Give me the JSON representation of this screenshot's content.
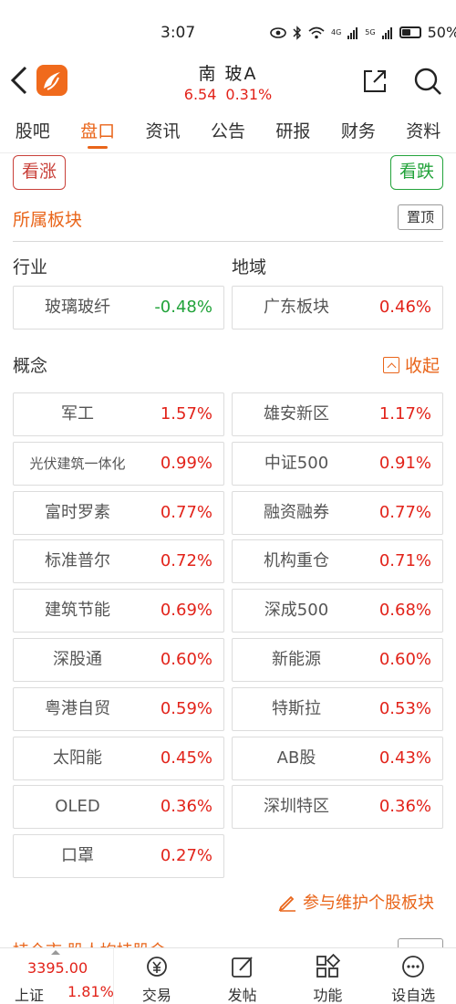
{
  "status": {
    "time": "3:07",
    "net1": "4G",
    "net2": "5G",
    "battery": "50%"
  },
  "header": {
    "name": "南 玻A",
    "price": "6.54",
    "change": "0.31%"
  },
  "tabs": [
    "股吧",
    "盘口",
    "资讯",
    "公告",
    "研报",
    "财务",
    "资料"
  ],
  "buttons": {
    "rise": "看涨",
    "fall": "看跌",
    "top": "置顶",
    "collapse": "收起",
    "maintain": "参与维护个股板块"
  },
  "section": {
    "title": "所属板块",
    "industry_label": "行业",
    "region_label": "地域",
    "concept_label": "概念"
  },
  "industry": {
    "name": "玻璃玻纤",
    "pct": "-0.48%"
  },
  "region": {
    "name": "广东板块",
    "pct": "0.46%"
  },
  "concepts": [
    {
      "name": "军工",
      "pct": "1.57%"
    },
    {
      "name": "雄安新区",
      "pct": "1.17%"
    },
    {
      "name": "光伏建筑一体化",
      "pct": "0.99%"
    },
    {
      "name": "中证500",
      "pct": "0.91%"
    },
    {
      "name": "富时罗素",
      "pct": "0.77%"
    },
    {
      "name": "融资融券",
      "pct": "0.77%"
    },
    {
      "name": "标准普尔",
      "pct": "0.72%"
    },
    {
      "name": "机构重仓",
      "pct": "0.71%"
    },
    {
      "name": "建筑节能",
      "pct": "0.69%"
    },
    {
      "name": "深成500",
      "pct": "0.68%"
    },
    {
      "name": "深股通",
      "pct": "0.60%"
    },
    {
      "name": "新能源",
      "pct": "0.60%"
    },
    {
      "name": "粤港自贸",
      "pct": "0.59%"
    },
    {
      "name": "特斯拉",
      "pct": "0.53%"
    },
    {
      "name": "太阳能",
      "pct": "0.45%"
    },
    {
      "name": "AB股",
      "pct": "0.43%"
    },
    {
      "name": "OLED",
      "pct": "0.36%"
    },
    {
      "name": "深圳特区",
      "pct": "0.36%"
    },
    {
      "name": "口罩",
      "pct": "0.27%"
    }
  ],
  "peek": {
    "text": "持仓市·股人均持股金"
  },
  "bottom": {
    "index_value": "3395.00",
    "index_name": "上证",
    "index_pct": "1.81%",
    "nav": [
      "交易",
      "发帖",
      "功能",
      "设自选"
    ]
  },
  "colors": {
    "accent": "#e9651a",
    "up": "#e2231a",
    "down": "#21a33a"
  }
}
